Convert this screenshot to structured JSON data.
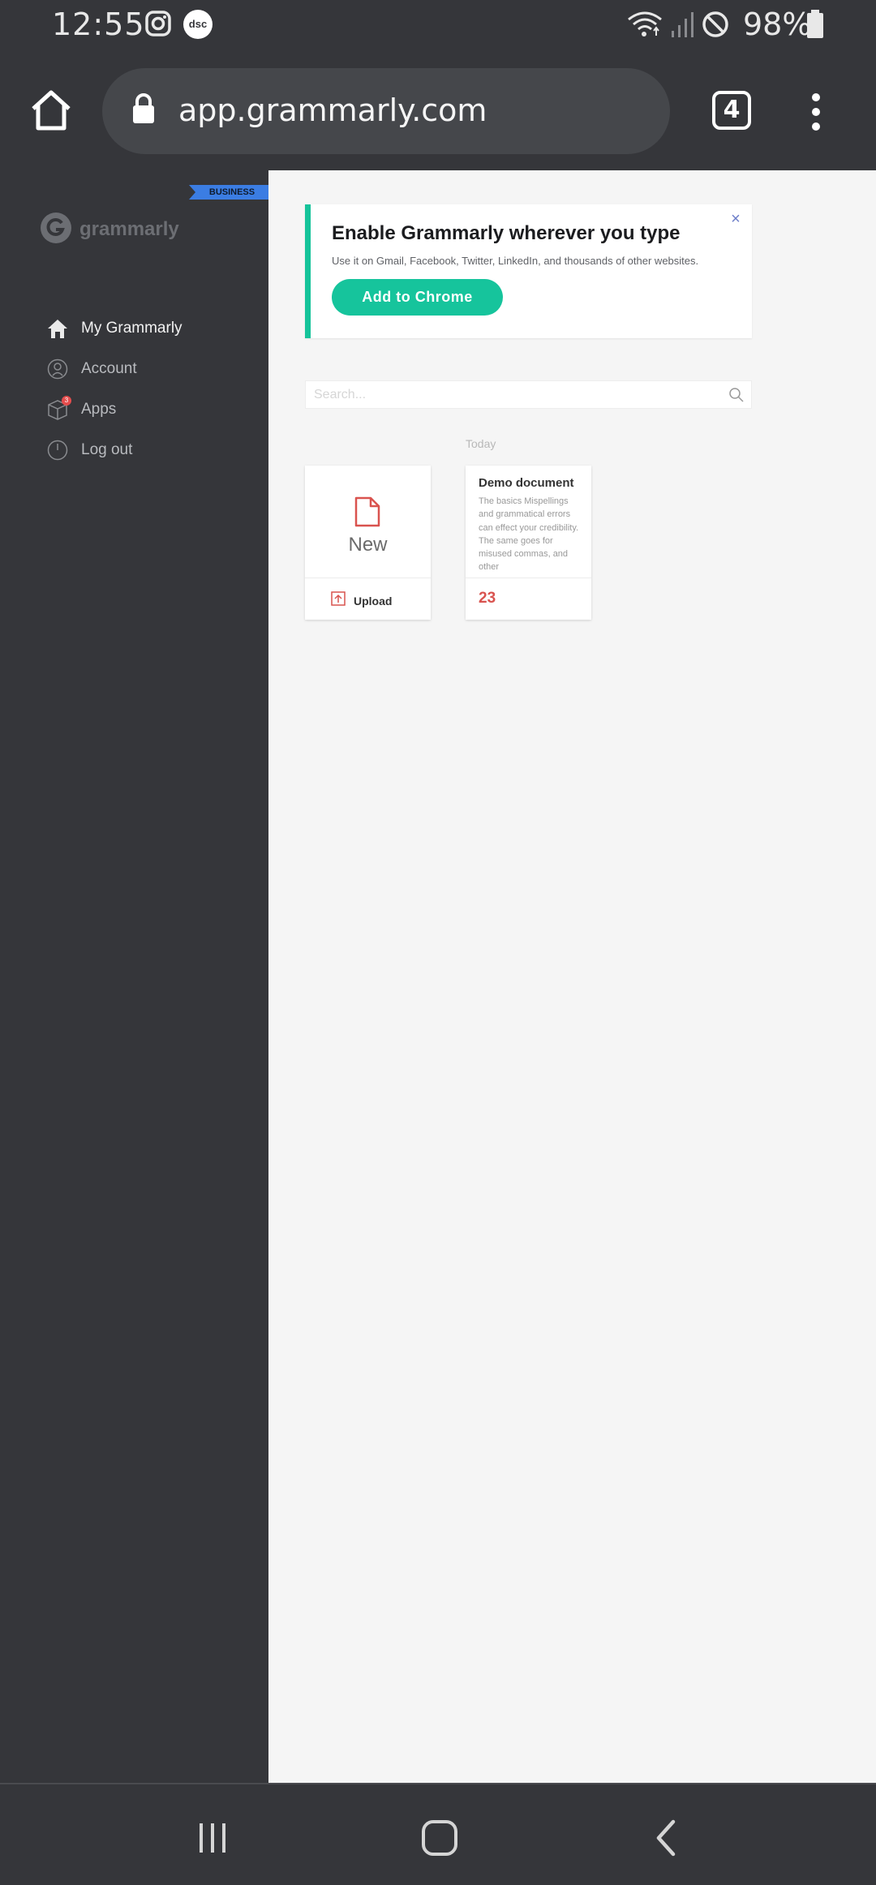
{
  "status_bar": {
    "time": "12:55",
    "battery_percent": "98%",
    "icons": [
      "instagram-icon",
      "dsc-icon",
      "wifi-icon",
      "signal-icon",
      "do-not-disturb-icon",
      "battery-icon"
    ],
    "dsc_badge": "dsc"
  },
  "browser": {
    "url": "app.grammarly.com",
    "tab_count": "4"
  },
  "sidebar": {
    "badge": "BUSINESS",
    "logo_text": "grammarly",
    "items": [
      {
        "label": "My Grammarly",
        "icon": "home-icon"
      },
      {
        "label": "Account",
        "icon": "account-icon"
      },
      {
        "label": "Apps",
        "icon": "apps-box-icon",
        "badge": "3"
      },
      {
        "label": "Log out",
        "icon": "power-icon"
      }
    ]
  },
  "banner": {
    "title": "Enable Grammarly wherever you type",
    "description": "Use it on Gmail, Facebook, Twitter, LinkedIn, and thousands of other websites.",
    "button_label": "Add to Chrome",
    "close_symbol": "×"
  },
  "search": {
    "placeholder": "Search..."
  },
  "documents": {
    "section_label": "Today",
    "new_card": {
      "label": "New",
      "upload_label": "Upload"
    },
    "items": [
      {
        "title": "Demo document",
        "preview": "The basics Mispellings and grammatical errors can effect your credibility. The same goes for misused commas, and other",
        "score": "23"
      }
    ]
  },
  "colors": {
    "accent": "#15c39a",
    "sidebar_bg": "#35363a",
    "main_bg": "#f5f5f5",
    "score_red": "#d9534f",
    "business_blue": "#3b7de3"
  }
}
